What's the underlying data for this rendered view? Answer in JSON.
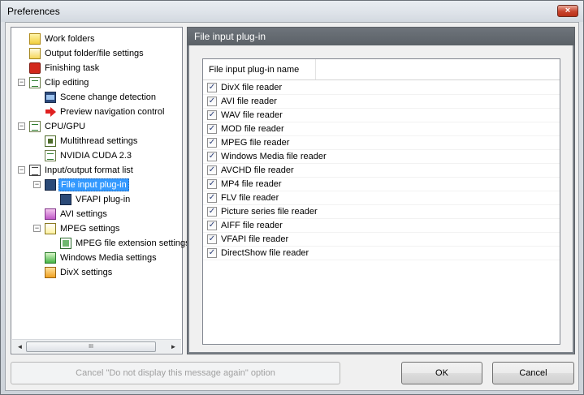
{
  "window": {
    "title": "Preferences",
    "close_label": "×"
  },
  "tree": {
    "items": [
      {
        "label": "Work folders",
        "icon": "folder-icon"
      },
      {
        "label": "Output folder/file settings",
        "icon": "folder-settings-icon"
      },
      {
        "label": "Finishing task",
        "icon": "power-icon"
      },
      {
        "label": "Clip editing",
        "icon": "document-icon"
      },
      {
        "label": "Scene change detection",
        "icon": "film-icon"
      },
      {
        "label": "Preview navigation control",
        "icon": "arrow-icon"
      },
      {
        "label": "CPU/GPU",
        "icon": "document-icon"
      },
      {
        "label": "Multithread settings",
        "icon": "document-icon"
      },
      {
        "label": "NVIDIA CUDA 2.3",
        "icon": "document-icon"
      },
      {
        "label": "Input/output format list",
        "icon": "list-icon"
      },
      {
        "label": "File input plug-in",
        "icon": "plug-icon"
      },
      {
        "label": "VFAPI plug-in",
        "icon": "plug-icon"
      },
      {
        "label": "AVI settings",
        "icon": "avi-icon"
      },
      {
        "label": "MPEG settings",
        "icon": "mpeg-icon"
      },
      {
        "label": "MPEG file extension settings",
        "icon": "mpeg-extension-icon"
      },
      {
        "label": "Windows Media settings",
        "icon": "windows-media-icon"
      },
      {
        "label": "DivX settings",
        "icon": "divx-icon"
      }
    ],
    "selected": "File input plug-in",
    "scroll_thumb_label": "III",
    "scroll_left": "◄",
    "scroll_right": "►"
  },
  "panel": {
    "title": "File input plug-in",
    "column_header": "File input plug-in name",
    "rows": [
      {
        "label": "DivX file reader",
        "checked": true
      },
      {
        "label": "AVI file reader",
        "checked": true
      },
      {
        "label": "WAV file reader",
        "checked": true
      },
      {
        "label": "MOD file reader",
        "checked": true
      },
      {
        "label": "MPEG file reader",
        "checked": true
      },
      {
        "label": "Windows Media file reader",
        "checked": true
      },
      {
        "label": "AVCHD file reader",
        "checked": true
      },
      {
        "label": "MP4 file reader",
        "checked": true
      },
      {
        "label": "FLV file reader",
        "checked": true
      },
      {
        "label": "Picture series file reader",
        "checked": true
      },
      {
        "label": "AIFF file reader",
        "checked": true
      },
      {
        "label": "VFAPI file reader",
        "checked": true
      },
      {
        "label": "DirectShow file reader",
        "checked": true
      }
    ],
    "check_mark": "✓"
  },
  "buttons": {
    "cancel_message": "Cancel \"Do not display this message again\" option",
    "ok": "OK",
    "cancel": "Cancel"
  }
}
